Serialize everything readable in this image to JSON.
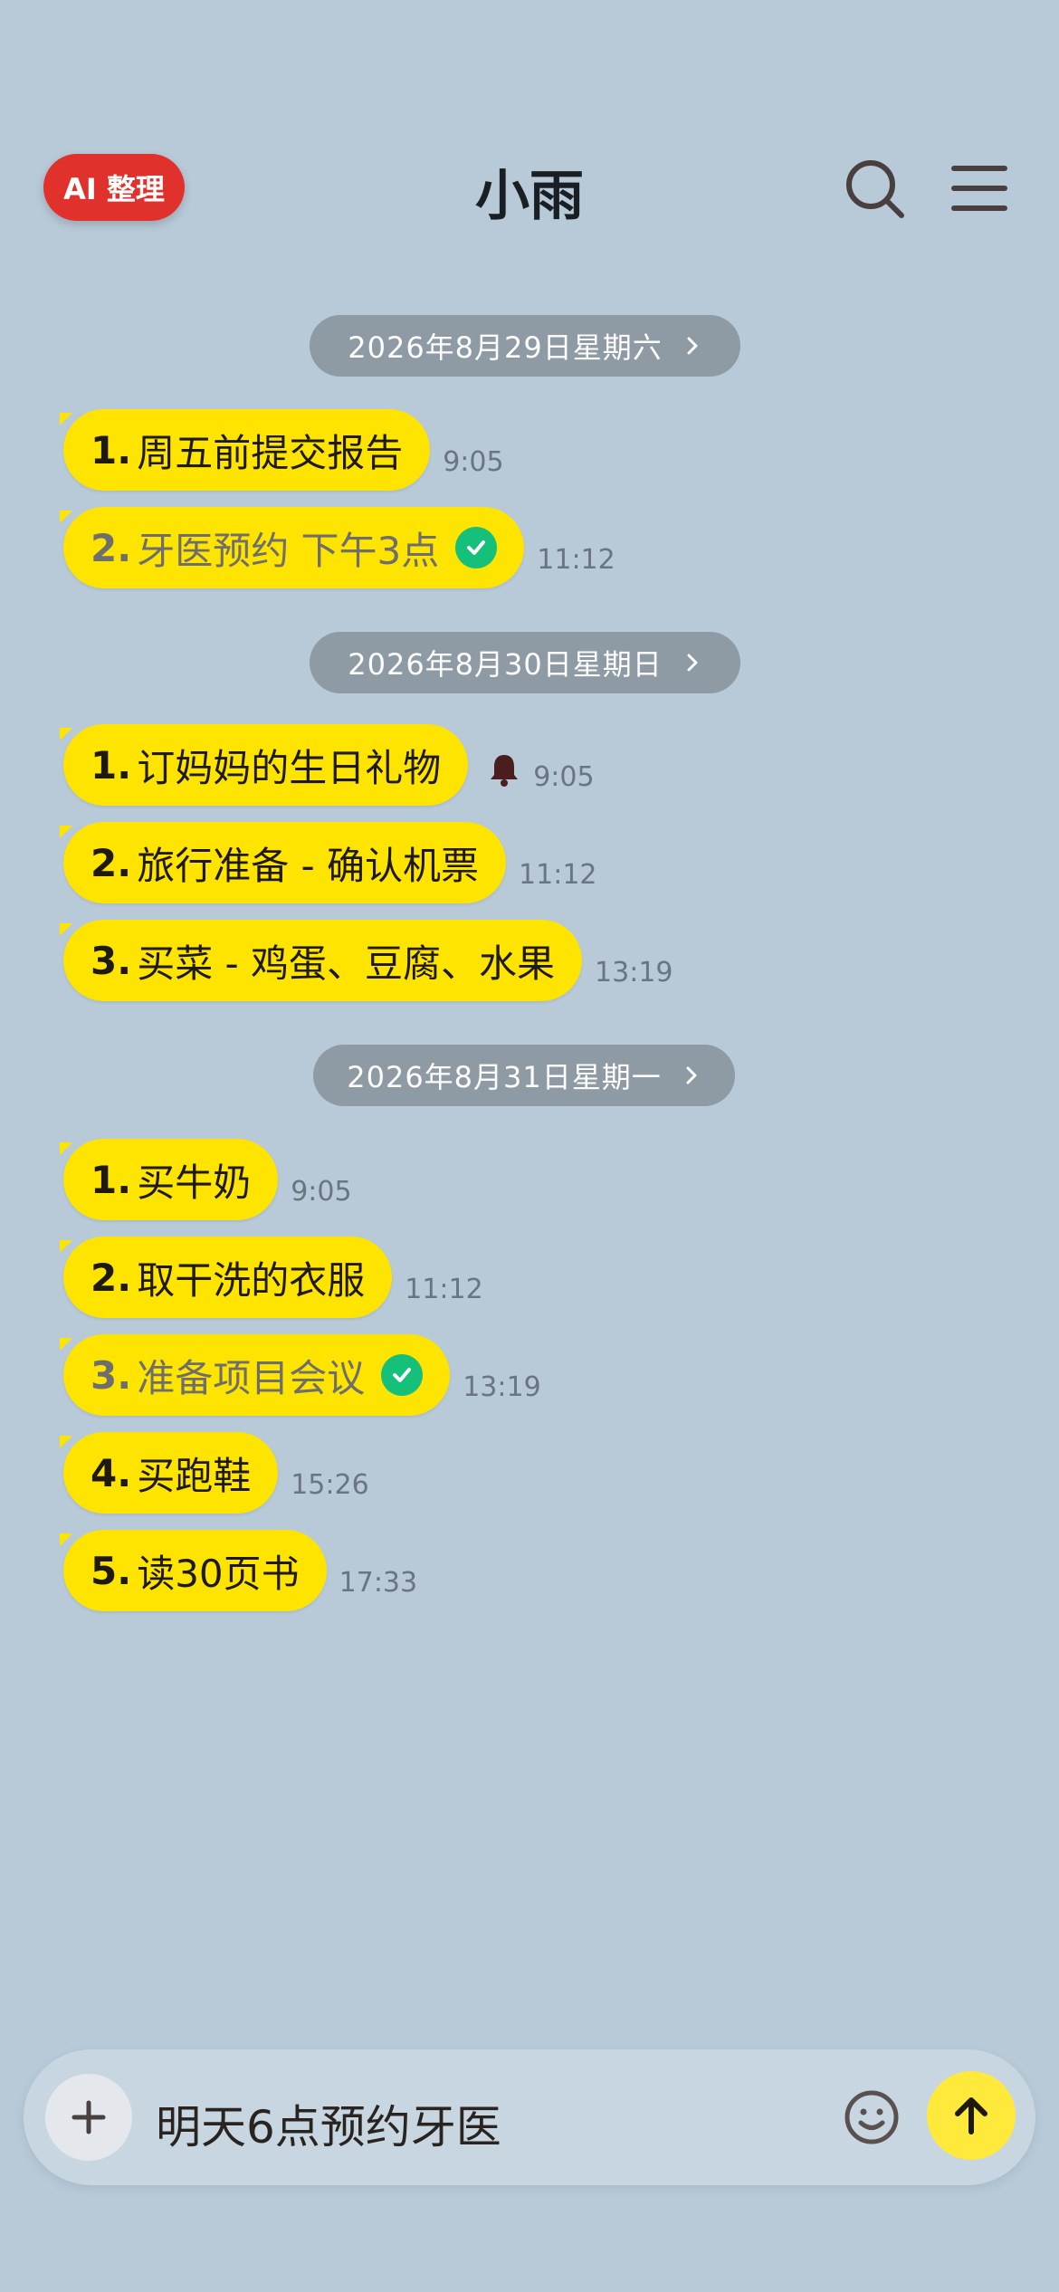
{
  "header": {
    "ai_button_label": "AI 整理",
    "title": "小雨",
    "icons": [
      "search-icon",
      "menu-icon"
    ]
  },
  "groups": [
    {
      "date": "2026年8月29日星期六",
      "items": [
        {
          "num": "1.",
          "text": "周五前提交报告",
          "time": "9:05",
          "done": false,
          "reminder": false
        },
        {
          "num": "2.",
          "text": "牙医预约 下午3点",
          "time": "11:12",
          "done": true,
          "reminder": false
        }
      ]
    },
    {
      "date": "2026年8月30日星期日",
      "items": [
        {
          "num": "1.",
          "text": "订妈妈的生日礼物",
          "time": "9:05",
          "done": false,
          "reminder": true
        },
        {
          "num": "2.",
          "text": "旅行准备 - 确认机票",
          "time": "11:12",
          "done": false,
          "reminder": false
        },
        {
          "num": "3.",
          "text": "买菜 - 鸡蛋、豆腐、水果",
          "time": "13:19",
          "done": false,
          "reminder": false
        }
      ]
    },
    {
      "date": "2026年8月31日星期一",
      "items": [
        {
          "num": "1.",
          "text": "买牛奶",
          "time": "9:05",
          "done": false,
          "reminder": false
        },
        {
          "num": "2.",
          "text": "取干洗的衣服",
          "time": "11:12",
          "done": false,
          "reminder": false
        },
        {
          "num": "3.",
          "text": "准备项目会议",
          "time": "13:19",
          "done": true,
          "reminder": false
        },
        {
          "num": "4.",
          "text": "买跑鞋",
          "time": "15:26",
          "done": false,
          "reminder": false
        },
        {
          "num": "5.",
          "text": "读30页书",
          "time": "17:33",
          "done": false,
          "reminder": false
        }
      ]
    }
  ],
  "input": {
    "value": "明天6点预约牙医",
    "icons": [
      "plus-icon",
      "emoji-icon",
      "send-arrow-icon"
    ]
  },
  "colors": {
    "background": "#b8cad8",
    "bubble": "#ffe400",
    "ai_button": "#e0312d",
    "check": "#14c07a",
    "date_pill": "#8e9aa4",
    "send_button": "#ffe93a"
  }
}
